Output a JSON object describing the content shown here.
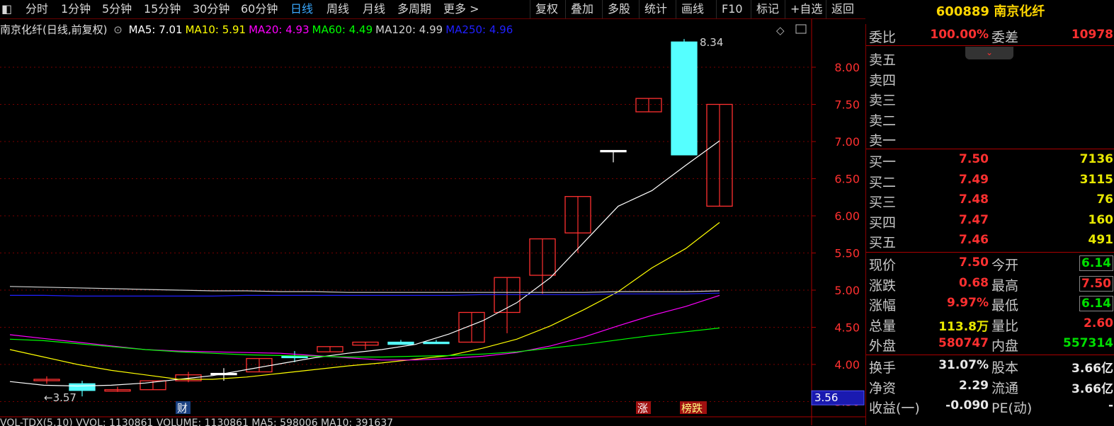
{
  "toolbar": {
    "left_items": [
      "分时",
      "1分钟",
      "5分钟",
      "15分钟",
      "30分钟",
      "60分钟",
      "日线",
      "周线",
      "月线",
      "多周期",
      "更多 >"
    ],
    "active": "日线",
    "right_items": [
      "复权",
      "叠加",
      "多股",
      "统计",
      "画线",
      "F10",
      "标记",
      "+自选",
      "返回"
    ]
  },
  "stock_title": "600889 南京化纤",
  "ma_legend": {
    "name": "南京化纤(日线,前复权)",
    "items": [
      {
        "label": "MA5: 7.01",
        "color": "#ffffff"
      },
      {
        "label": "MA10: 5.91",
        "color": "#ffff00"
      },
      {
        "label": "MA20: 4.93",
        "color": "#ff00ff"
      },
      {
        "label": "MA60: 4.49",
        "color": "#00ff00"
      },
      {
        "label": "MA120: 4.99",
        "color": "#d0d0d0"
      },
      {
        "label": "MA250: 4.96",
        "color": "#2020ff"
      }
    ]
  },
  "chart_data": {
    "type": "candlestick",
    "ylim": [
      3.4,
      8.45
    ],
    "yticks": [
      "8.00",
      "7.50",
      "7.00",
      "6.50",
      "6.00",
      "5.50",
      "5.00",
      "4.50",
      "4.00",
      "3.50"
    ],
    "high_label": "8.34",
    "low_label": "←3.57",
    "price_tag": "3.56",
    "candles": [
      {
        "o": 3.8,
        "c": 3.8,
        "h": 3.84,
        "l": 3.74,
        "color": "#ff3030"
      },
      {
        "o": 3.74,
        "c": 3.65,
        "h": 3.78,
        "l": 3.57,
        "color": "#55ffff"
      },
      {
        "o": 3.66,
        "c": 3.66,
        "h": 3.7,
        "l": 3.63,
        "color": "#ff3030"
      },
      {
        "o": 3.66,
        "c": 3.78,
        "h": 3.78,
        "l": 3.66,
        "color": "#ff3030"
      },
      {
        "o": 3.78,
        "c": 3.86,
        "h": 3.9,
        "l": 3.76,
        "color": "#ff3030"
      },
      {
        "o": 3.88,
        "c": 3.88,
        "h": 3.95,
        "l": 3.78,
        "color": "#ffffff"
      },
      {
        "o": 3.9,
        "c": 4.08,
        "h": 4.08,
        "l": 3.9,
        "color": "#ff3030"
      },
      {
        "o": 4.11,
        "c": 4.11,
        "h": 4.18,
        "l": 4.03,
        "color": "#55ffff"
      },
      {
        "o": 4.17,
        "c": 4.24,
        "h": 4.24,
        "l": 4.17,
        "color": "#ff3030"
      },
      {
        "o": 4.26,
        "c": 4.3,
        "h": 4.3,
        "l": 4.2,
        "color": "#ff3030"
      },
      {
        "o": 4.3,
        "c": 4.27,
        "h": 4.33,
        "l": 4.27,
        "color": "#55ffff"
      },
      {
        "o": 4.3,
        "c": 4.28,
        "h": 4.33,
        "l": 4.28,
        "color": "#55ffff"
      },
      {
        "o": 4.3,
        "c": 4.7,
        "h": 4.7,
        "l": 4.3,
        "color": "#ff3030"
      },
      {
        "o": 4.7,
        "c": 5.17,
        "h": 5.17,
        "l": 4.42,
        "color": "#ff3030"
      },
      {
        "o": 5.2,
        "c": 5.69,
        "h": 5.69,
        "l": 4.95,
        "color": "#ff3030"
      },
      {
        "o": 5.77,
        "c": 6.26,
        "h": 6.26,
        "l": 5.5,
        "color": "#ff3030"
      },
      {
        "o": 6.88,
        "c": 6.88,
        "h": 6.88,
        "l": 6.72,
        "color": "#ffffff"
      },
      {
        "o": 7.4,
        "c": 7.58,
        "h": 7.58,
        "l": 7.4,
        "color": "#ff3030"
      },
      {
        "o": 8.34,
        "c": 6.82,
        "h": 8.38,
        "l": 6.82,
        "color": "#55ffff"
      },
      {
        "o": 6.13,
        "c": 7.5,
        "h": 7.5,
        "l": 6.13,
        "color": "#ff3030"
      }
    ],
    "ma_series": [
      {
        "name": "MA5",
        "color": "#ffffff",
        "values": [
          3.77,
          3.72,
          3.71,
          3.72,
          3.75,
          3.8,
          3.85,
          3.93,
          4.01,
          4.09,
          4.15,
          4.2,
          4.27,
          4.41,
          4.59,
          4.83,
          5.17,
          5.65,
          6.13,
          6.34,
          6.68,
          7.01
        ]
      },
      {
        "name": "MA10",
        "color": "#ffff00",
        "values": [
          4.2,
          4.1,
          4.0,
          3.92,
          3.86,
          3.8,
          3.8,
          3.83,
          3.88,
          3.93,
          3.98,
          4.02,
          4.07,
          4.12,
          4.22,
          4.34,
          4.52,
          4.74,
          4.98,
          5.3,
          5.56,
          5.91
        ]
      },
      {
        "name": "MA20",
        "color": "#ff00ff",
        "values": [
          4.4,
          4.35,
          4.3,
          4.25,
          4.2,
          4.18,
          4.17,
          4.16,
          4.15,
          4.12,
          4.09,
          4.06,
          4.06,
          4.08,
          4.11,
          4.16,
          4.25,
          4.37,
          4.52,
          4.66,
          4.78,
          4.93
        ]
      },
      {
        "name": "MA60",
        "color": "#00ff00",
        "values": [
          4.34,
          4.32,
          4.28,
          4.24,
          4.2,
          4.17,
          4.15,
          4.13,
          4.12,
          4.11,
          4.1,
          4.1,
          4.11,
          4.12,
          4.14,
          4.17,
          4.22,
          4.27,
          4.33,
          4.39,
          4.44,
          4.49
        ]
      },
      {
        "name": "MA120",
        "color": "#d0d0d0",
        "values": [
          5.05,
          5.04,
          5.03,
          5.02,
          5.01,
          5.0,
          4.99,
          4.99,
          4.98,
          4.98,
          4.97,
          4.97,
          4.97,
          4.97,
          4.97,
          4.97,
          4.97,
          4.97,
          4.98,
          4.98,
          4.98,
          4.99
        ]
      },
      {
        "name": "MA250",
        "color": "#2020ff",
        "values": [
          4.93,
          4.93,
          4.92,
          4.92,
          4.92,
          4.92,
          4.92,
          4.93,
          4.93,
          4.93,
          4.93,
          4.93,
          4.93,
          4.93,
          4.94,
          4.94,
          4.94,
          4.94,
          4.95,
          4.95,
          4.95,
          4.96
        ]
      }
    ],
    "markers": [
      {
        "label": "财",
        "index": 4,
        "bg": "#1a4080"
      },
      {
        "label": "涨",
        "index": 17,
        "bg": "#a01010"
      },
      {
        "label": "榜跌",
        "index": 18,
        "bg": "#a01010"
      }
    ]
  },
  "bottom_legend": "VOL-TDX(5,10) VVOL: 1130861 VOLUME: 1130861 MA5: 598006 MA10: 391637",
  "panel": {
    "weibi": {
      "label": "委比",
      "value": "100.00%",
      "label2": "委差",
      "value2": "10978"
    },
    "sell": [
      {
        "label": "卖五"
      },
      {
        "label": "卖四"
      },
      {
        "label": "卖三"
      },
      {
        "label": "卖二"
      },
      {
        "label": "卖一"
      }
    ],
    "buy": [
      {
        "label": "买一",
        "price": "7.50",
        "vol": "7136"
      },
      {
        "label": "买二",
        "price": "7.49",
        "vol": "3115"
      },
      {
        "label": "买三",
        "price": "7.48",
        "vol": "76"
      },
      {
        "label": "买四",
        "price": "7.47",
        "vol": "160"
      },
      {
        "label": "买五",
        "price": "7.46",
        "vol": "491"
      }
    ],
    "stats1": [
      {
        "label": "现价",
        "value": "7.50",
        "vcolor": "red",
        "label2": "今开",
        "value2": "6.14",
        "v2color": "green",
        "boxed": true
      },
      {
        "label": "涨跌",
        "value": "0.68",
        "vcolor": "red",
        "label2": "最高",
        "value2": "7.50",
        "v2color": "red",
        "boxed": true
      },
      {
        "label": "涨幅",
        "value": "9.97%",
        "vcolor": "red",
        "label2": "最低",
        "value2": "6.14",
        "v2color": "green",
        "boxed": true
      },
      {
        "label": "总量",
        "value": "113.8万",
        "vcolor": "yellow",
        "label2": "量比",
        "value2": "2.60",
        "v2color": "red",
        "boxed": false
      },
      {
        "label": "外盘",
        "value": "580747",
        "vcolor": "red",
        "label2": "内盘",
        "value2": "557314",
        "v2color": "green",
        "boxed": false
      }
    ],
    "stats2": [
      {
        "label": "换手",
        "value": "31.07%",
        "vcolor": "white",
        "label2": "股本",
        "value2": "3.66亿",
        "v2color": "white"
      },
      {
        "label": "净资",
        "value": "2.29",
        "vcolor": "white",
        "label2": "流通",
        "value2": "3.66亿",
        "v2color": "white"
      },
      {
        "label": "收益(一)",
        "value": "-0.090",
        "vcolor": "white",
        "label2": "PE(动)",
        "value2": "-",
        "v2color": "white"
      }
    ]
  }
}
